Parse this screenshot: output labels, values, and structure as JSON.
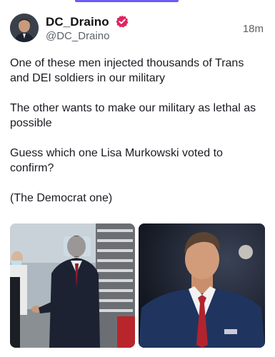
{
  "post": {
    "author_name": "DC_Draino",
    "handle": "@DC_Draino",
    "timestamp": "18m",
    "paragraphs": [
      "One of these men injected thousands of Trans and DEI soldiers in our military",
      "The other wants to make our military as lethal as possible",
      "Guess which one Lisa Murkowski voted to confirm?",
      "(The Democrat one)"
    ],
    "media": [
      {
        "kind": "photo",
        "subject": "man-in-dark-suit-with-face-shield"
      },
      {
        "kind": "photo",
        "subject": "man-in-navy-suit-red-tie"
      }
    ]
  },
  "colors": {
    "accent": "#6b5cf6",
    "verified_badge": "#e0245e",
    "secondary_text": "#5b6068"
  },
  "icons": {
    "verified": "verified-badge-icon"
  }
}
